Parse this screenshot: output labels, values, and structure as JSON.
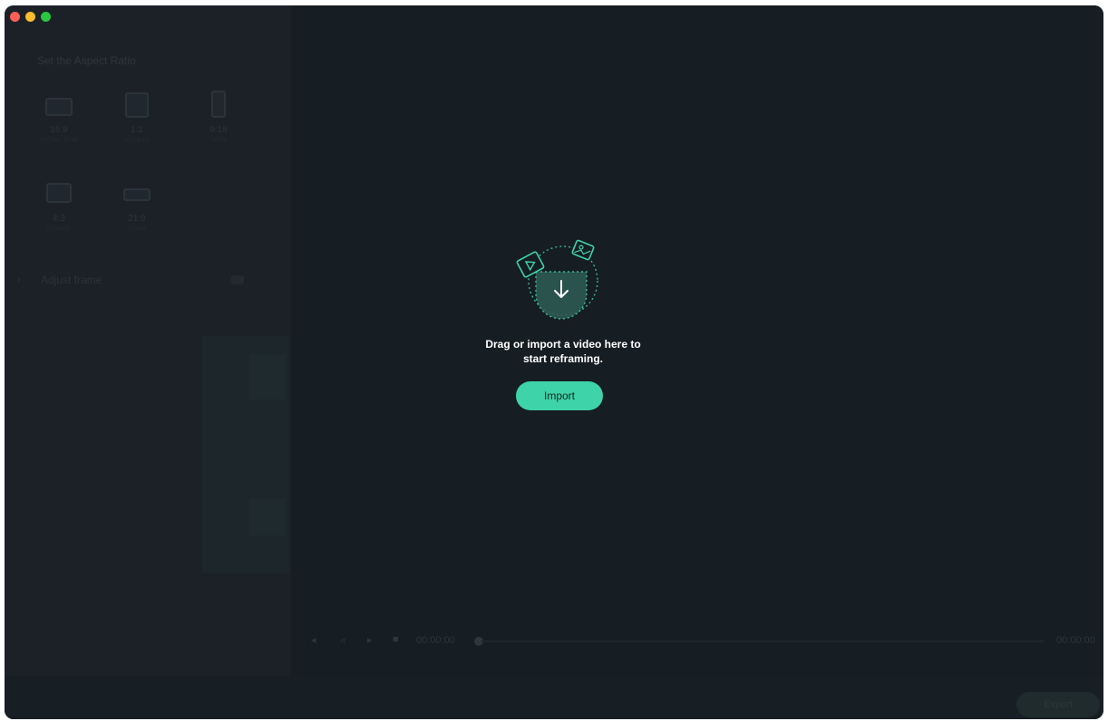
{
  "window": {
    "controls": [
      "close",
      "minimize",
      "zoom"
    ]
  },
  "left_panel": {
    "title": "Set the Aspect Ratio",
    "ratios": [
      {
        "label": "16:9",
        "sub": "YouTube, Twitter"
      },
      {
        "label": "1:1",
        "sub": "Instagram"
      },
      {
        "label": "9:16",
        "sub": "TikTok"
      },
      {
        "label": "4:3",
        "sub": "Facebook"
      },
      {
        "label": "21:9",
        "sub": "Cinema"
      }
    ],
    "adjust_frame_label": "Adjust frame"
  },
  "center": {
    "drop_text_line1": "Drag or import a video here to",
    "drop_text_line2": "start reframing.",
    "import_label": "Import"
  },
  "playback": {
    "current_time": "00:00:00",
    "total_time": "00:00:00"
  },
  "footer": {
    "export_label": "Export"
  },
  "colors": {
    "accent": "#3ed3a8",
    "background": "#161d23",
    "panel": "#1b2127"
  }
}
